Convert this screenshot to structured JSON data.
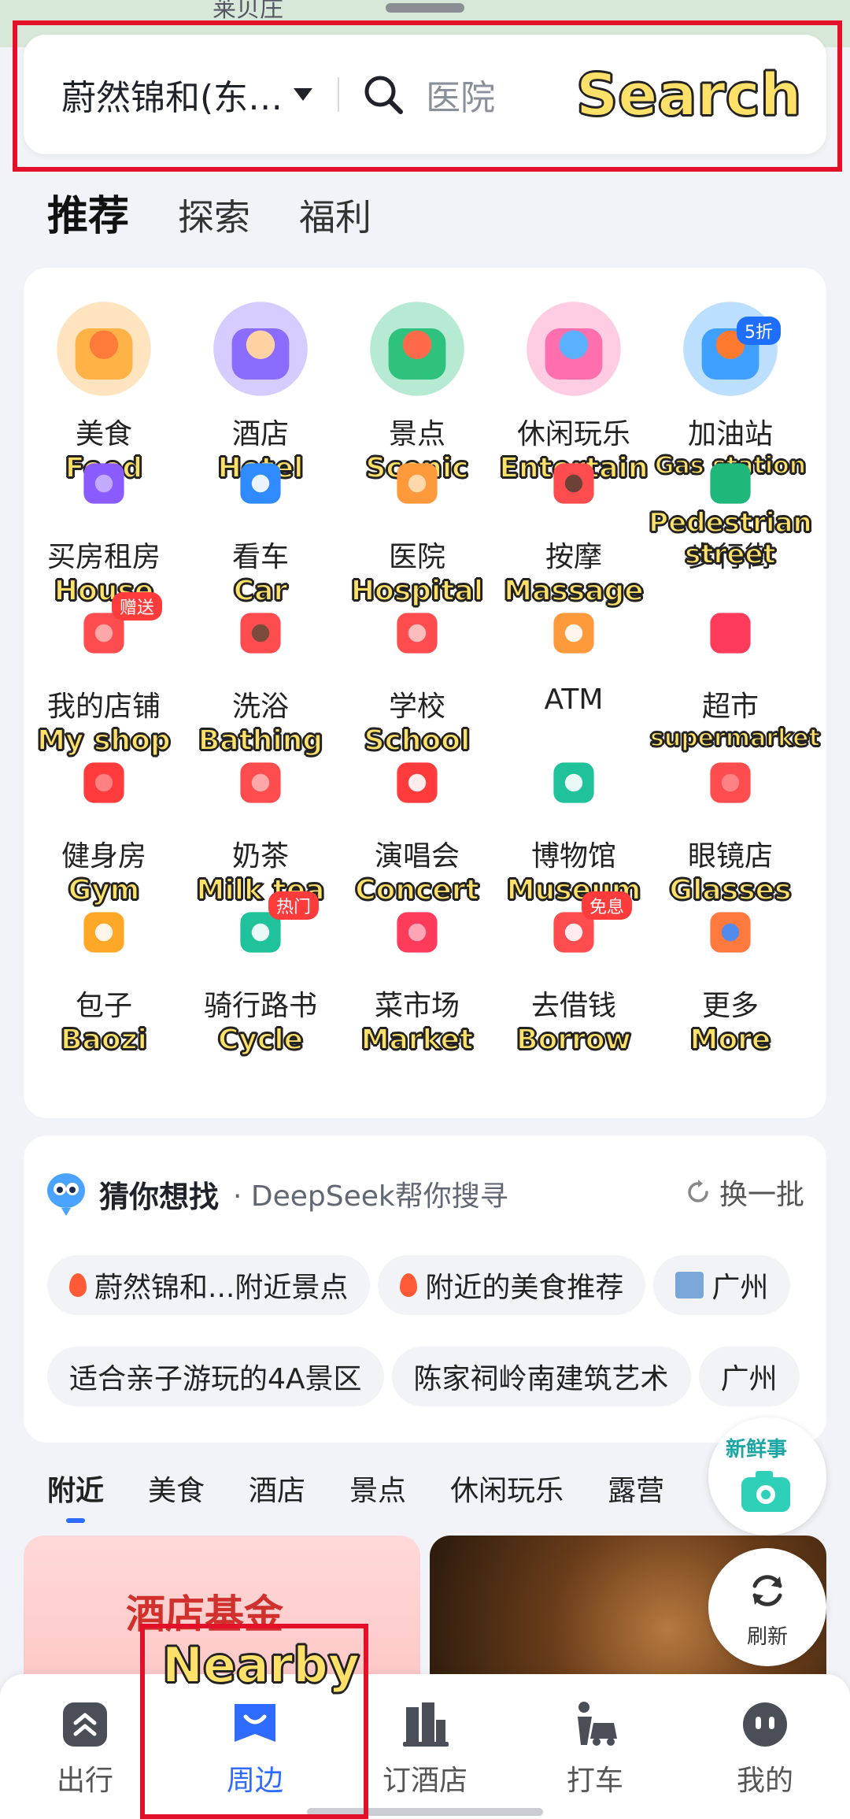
{
  "map": {
    "place_label": "莱贝庄"
  },
  "search": {
    "location": "蔚然锦和(东…",
    "placeholder": "医院"
  },
  "annotations": {
    "search": "Search",
    "nearby": "Nearby"
  },
  "top_tabs": [
    {
      "label": "推荐",
      "active": true
    },
    {
      "label": "探索",
      "active": false
    },
    {
      "label": "福利",
      "active": false
    }
  ],
  "categories": [
    {
      "label": "美食",
      "en": "Food",
      "icon": "roast-chicken-icon"
    },
    {
      "label": "酒店",
      "en": "Hotel",
      "icon": "hotel-clerk-icon"
    },
    {
      "label": "景点",
      "en": "Scenic",
      "icon": "palace-icon"
    },
    {
      "label": "休闲玩乐",
      "en": "Entertain",
      "icon": "gamepad-icon"
    },
    {
      "label": "加油站",
      "en": "Gas station",
      "icon": "gas-pump-icon",
      "badge": "5折"
    },
    {
      "label": "买房租房",
      "en": "House",
      "icon": "house-search-icon"
    },
    {
      "label": "看车",
      "en": "Car",
      "icon": "car-icon"
    },
    {
      "label": "医院",
      "en": "Hospital",
      "icon": "hospital-icon"
    },
    {
      "label": "按摩",
      "en": "Massage",
      "icon": "massage-icon"
    },
    {
      "label": "步行街",
      "en": "Pedestrian street",
      "icon": "walking-icon"
    },
    {
      "label": "我的店铺",
      "en": "My shop",
      "icon": "shop-icon",
      "badge": "赠送"
    },
    {
      "label": "洗浴",
      "en": "Bathing",
      "icon": "bath-icon"
    },
    {
      "label": "学校",
      "en": "School",
      "icon": "graduation-cap-icon"
    },
    {
      "label": "ATM",
      "en": "",
      "icon": "atm-icon"
    },
    {
      "label": "超市",
      "en": "supermarket",
      "icon": "shopping-cart-icon"
    },
    {
      "label": "健身房",
      "en": "Gym",
      "icon": "dumbbell-icon"
    },
    {
      "label": "奶茶",
      "en": "Milk tea",
      "icon": "milk-tea-icon"
    },
    {
      "label": "演唱会",
      "en": "Concert",
      "icon": "speaker-icon"
    },
    {
      "label": "博物馆",
      "en": "Museum",
      "icon": "museum-icon"
    },
    {
      "label": "眼镜店",
      "en": "Glasses",
      "icon": "glasses-icon"
    },
    {
      "label": "包子",
      "en": "Baozi",
      "icon": "bun-icon"
    },
    {
      "label": "骑行路书",
      "en": "Cycle",
      "icon": "map-route-icon",
      "badge": "热门"
    },
    {
      "label": "菜市场",
      "en": "Market",
      "icon": "basket-icon"
    },
    {
      "label": "去借钱",
      "en": "Borrow",
      "icon": "money-bag-icon",
      "badge": "免息"
    },
    {
      "label": "更多",
      "en": "More",
      "icon": "grid-icon"
    }
  ],
  "guess": {
    "title": "猜你想找",
    "sub": "DeepSeek帮你搜寻",
    "refresh": "换一批",
    "row1": [
      "蔚然锦和...附近景点",
      "附近的美食推荐",
      "广州"
    ],
    "row2": [
      "适合亲子游玩的4A景区",
      "陈家祠岭南建筑艺术",
      "广州"
    ]
  },
  "category_tabs": [
    {
      "label": "附近",
      "active": true
    },
    {
      "label": "美食",
      "active": false
    },
    {
      "label": "酒店",
      "active": false
    },
    {
      "label": "景点",
      "active": false
    },
    {
      "label": "休闲玩乐",
      "active": false
    },
    {
      "label": "露营",
      "active": false
    }
  ],
  "feed": {
    "left_title": "酒店基金"
  },
  "floating": {
    "new_tag": "新鲜事",
    "refresh": "刷新"
  },
  "bottom_nav": [
    {
      "label": "出行",
      "icon": "travel-icon",
      "active": false
    },
    {
      "label": "周边",
      "icon": "nearby-icon",
      "active": true
    },
    {
      "label": "订酒店",
      "icon": "hotel-building-icon",
      "active": false
    },
    {
      "label": "打车",
      "icon": "taxi-icon",
      "active": false
    },
    {
      "label": "我的",
      "icon": "profile-icon",
      "active": false
    }
  ],
  "colors": {
    "accent": "#2f6bff",
    "annotation_red": "#e3102a",
    "annotation_text": "#ffe16a"
  }
}
